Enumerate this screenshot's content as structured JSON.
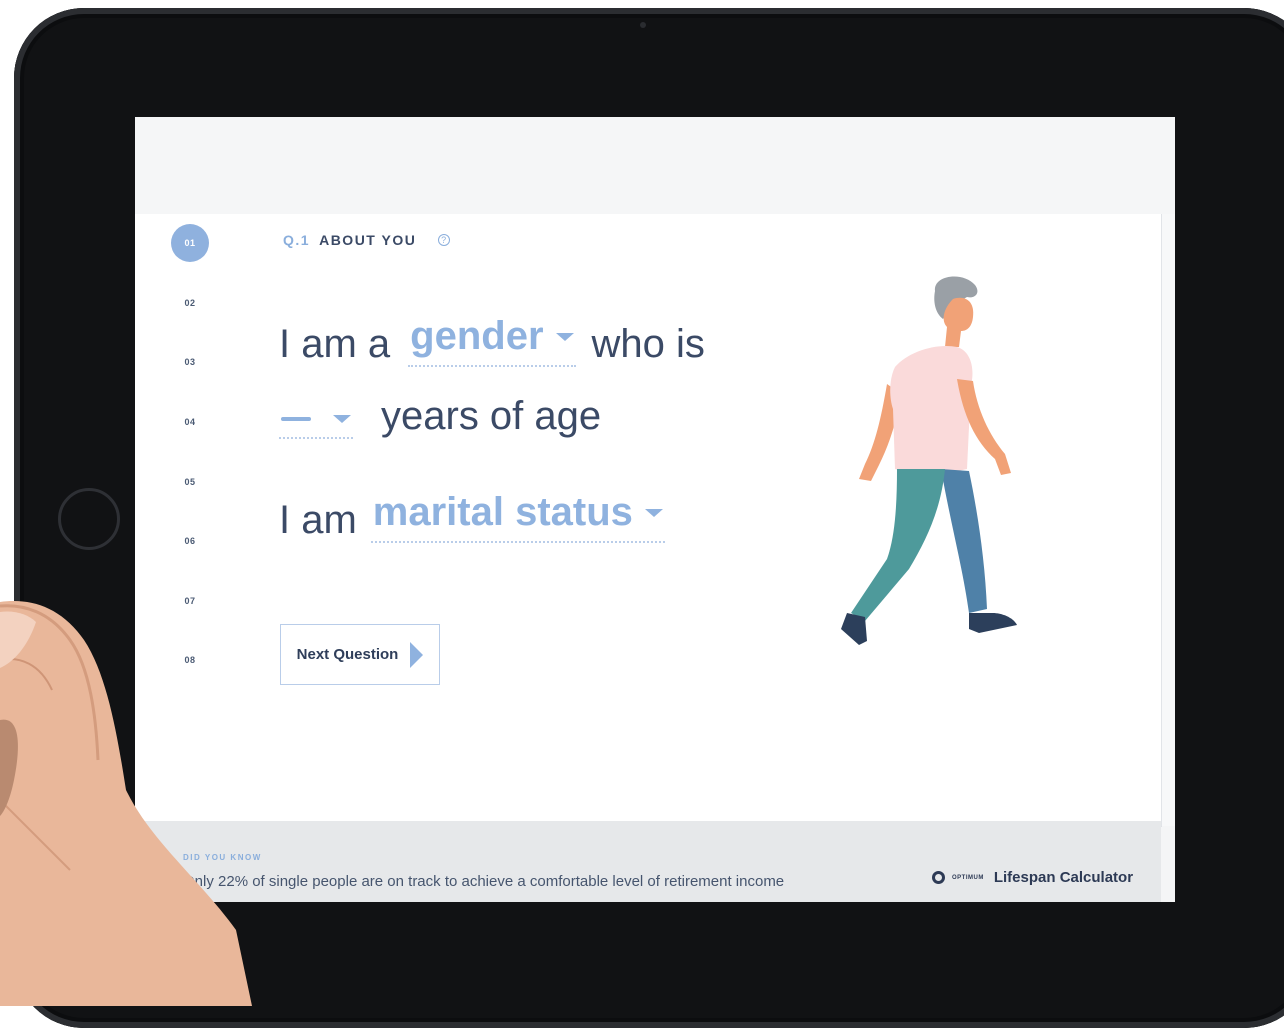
{
  "steps": [
    "01",
    "02",
    "03",
    "04",
    "05",
    "06",
    "07",
    "08"
  ],
  "active_step": "01",
  "question": {
    "number": "Q.1",
    "title": "ABOUT YOU",
    "help_icon": "question-circle-icon"
  },
  "sentence1": {
    "prefix": "I am a",
    "gender_value": "gender",
    "suffix": "who is"
  },
  "sentence2": {
    "suffix": "years of age"
  },
  "sentence3": {
    "prefix": "I am",
    "marital_value": "marital status"
  },
  "next_button": {
    "label": "Next Question",
    "icon": "play-arrow-icon"
  },
  "footer": {
    "did_you_know_label": "DID YOU KNOW",
    "fact": "Only 22% of single people are on track to achieve a comfortable level of retirement income",
    "brand_small": "OPTIMUM",
    "brand_name": "Lifespan Calculator"
  },
  "colors": {
    "accent": "#8fb2df",
    "text_dark": "#3b4a66",
    "footer_bg": "#e6e8ea"
  }
}
